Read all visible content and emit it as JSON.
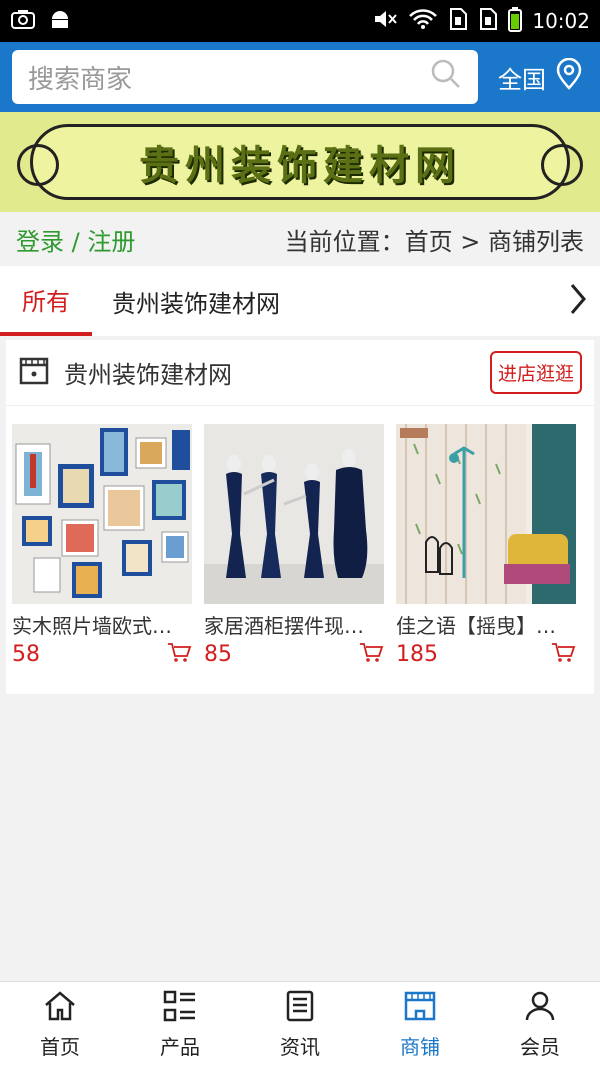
{
  "status": {
    "time": "10:02"
  },
  "search": {
    "placeholder": "搜索商家",
    "region": "全国"
  },
  "banner": {
    "title": "贵州装饰建材网"
  },
  "crumb": {
    "login": "登录 / 注册",
    "location": "当前位置：首页 > 商铺列表"
  },
  "tabs": [
    {
      "label": "所有"
    },
    {
      "label": "贵州装饰建材网"
    }
  ],
  "shop": {
    "name": "贵州装饰建材网",
    "visit_label": "进店逛逛",
    "products": [
      {
        "name": "实木照片墙欧式…",
        "price": "58"
      },
      {
        "name": "家居酒柜摆件现…",
        "price": "85"
      },
      {
        "name": "佳之语【摇曳】…",
        "price": "185"
      }
    ]
  },
  "nav": [
    {
      "label": "首页",
      "icon": "home-icon"
    },
    {
      "label": "产品",
      "icon": "grid-list-icon"
    },
    {
      "label": "资讯",
      "icon": "news-icon"
    },
    {
      "label": "商铺",
      "icon": "store-icon"
    },
    {
      "label": "会员",
      "icon": "user-icon"
    }
  ],
  "colors": {
    "primary": "#1b77c9",
    "accent": "#d21e1e",
    "login": "#2f9a2f",
    "banner": "#e2ea8e"
  }
}
